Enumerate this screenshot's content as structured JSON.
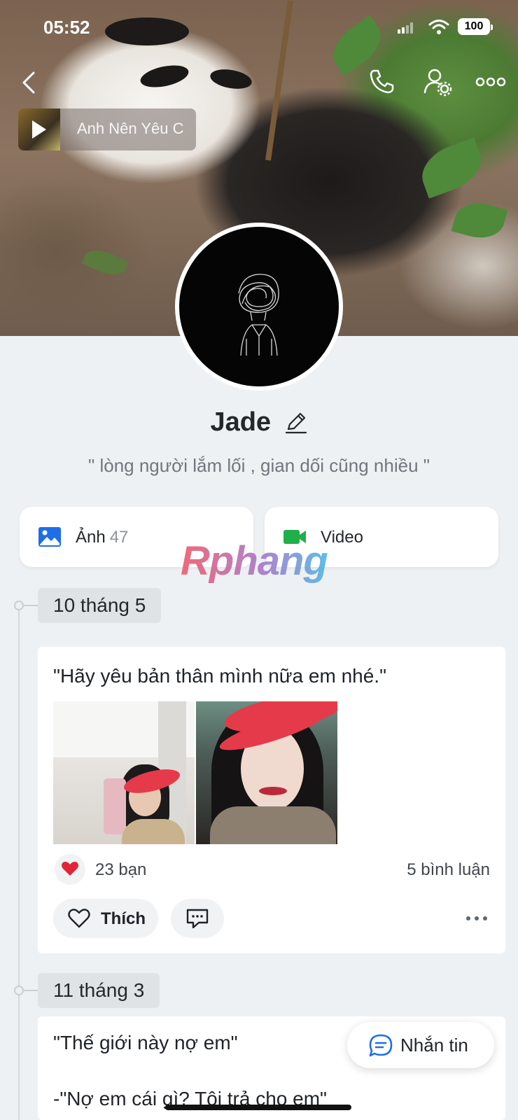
{
  "status_bar": {
    "time": "05:52",
    "battery": "100"
  },
  "music": {
    "title": "Anh Nên Yêu C"
  },
  "profile": {
    "name": "Jade",
    "bio": "\" lòng người lắm lối , gian dối cũng nhiều \""
  },
  "media": {
    "photos_label": "Ảnh",
    "photos_count": "47",
    "video_label": "Video"
  },
  "watermark": "Rphang",
  "timeline": [
    {
      "date": "10 tháng 5",
      "text": "\"Hãy yêu bản thân mình nữa em nhé.\"",
      "reactions": "23 bạn",
      "comments": "5 bình luận",
      "like_label": "Thích"
    },
    {
      "date": "11 tháng 3",
      "text": "\"Thế giới này nợ em\"",
      "text2": "-\"Nợ em cái gì? Tôi trả cho em\""
    }
  ],
  "message_button": {
    "label": "Nhắn tin"
  },
  "colors": {
    "accent_blue": "#1e6ee8",
    "video_green": "#20b04a",
    "heart_red": "#e0253a"
  }
}
